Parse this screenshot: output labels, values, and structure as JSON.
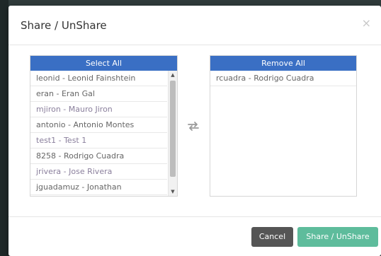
{
  "modal": {
    "title": "Share / UnShare",
    "close_glyph": "×"
  },
  "available": {
    "header": "Select All",
    "items": [
      "leonid - Leonid Fainshtein",
      "eran - Eran Gal",
      "mjiron - Mauro Jiron",
      "antonio - Antonio Montes",
      "test1 - Test 1",
      "8258 - Rodrigo Cuadra",
      "jrivera - Jose Rivera",
      "jguadamuz - Jonathan"
    ]
  },
  "selected": {
    "header": "Remove All",
    "items": [
      "rcuadra - Rodrigo Cuadra"
    ]
  },
  "footer": {
    "cancel_label": "Cancel",
    "share_label": "Share / UnShare"
  },
  "icons": {
    "transfer": "transfer-arrows-icon",
    "close": "close-icon"
  },
  "colors": {
    "header_blue": "#3a6fc4",
    "cancel_gray": "#555555",
    "share_green": "#5ebc9c"
  }
}
